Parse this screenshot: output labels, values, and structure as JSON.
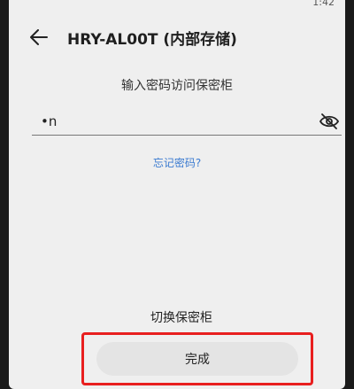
{
  "status_bar": {
    "time": "1:42"
  },
  "app_bar": {
    "title": "HRY-AL00T (内部存储)"
  },
  "prompt": "输入密码访问保密柜",
  "password": {
    "value": "•n"
  },
  "forgot_link": "忘记密码?",
  "buttons": {
    "switch_label": "切换保密柜",
    "done_label": "完成"
  },
  "colors": {
    "highlight": "#e81f1f",
    "link": "#3b7bd0",
    "background": "#efefef"
  },
  "icons": {
    "back": "arrow-left-icon",
    "visibility": "eye-off-icon"
  }
}
